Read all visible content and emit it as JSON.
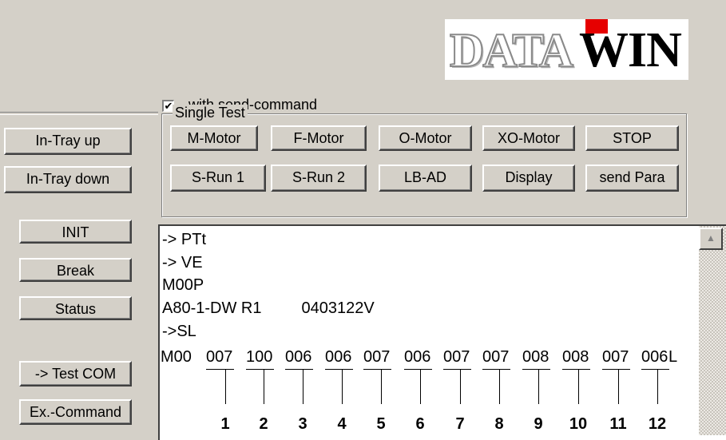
{
  "logo": {
    "part1": "DATA",
    "part2": "WIN"
  },
  "send_command": {
    "label": "with send-command",
    "checked": "✔"
  },
  "left_buttons": [
    "In-Tray up",
    "In-Tray down",
    "INIT",
    "Break",
    "Status",
    "-> Test COM",
    "Ex.-Command"
  ],
  "single_test": {
    "label": "Single Test",
    "row1": [
      "M-Motor",
      "F-Motor",
      "O-Motor",
      "XO-Motor",
      "STOP"
    ],
    "row2": [
      "S-Run 1",
      "S-Run 2",
      "LB-AD",
      "Display",
      "send Para"
    ]
  },
  "console": {
    "lines": [
      "-> PTt",
      "-> VE",
      "M00P",
      "A80-1-DW R1         0403122V",
      "->SL"
    ],
    "data_line": {
      "prefix": "M00 ",
      "values": [
        "007",
        "100",
        "006",
        "006",
        "007",
        "006",
        "007",
        "007",
        "008",
        "008",
        "007",
        "006"
      ],
      "suffix": "L"
    },
    "value_labels": [
      "1",
      "2",
      "3",
      "4",
      "5",
      "6",
      "7",
      "8",
      "9",
      "10",
      "11",
      "12"
    ]
  },
  "scrollbar": {
    "up_arrow": "▲"
  }
}
